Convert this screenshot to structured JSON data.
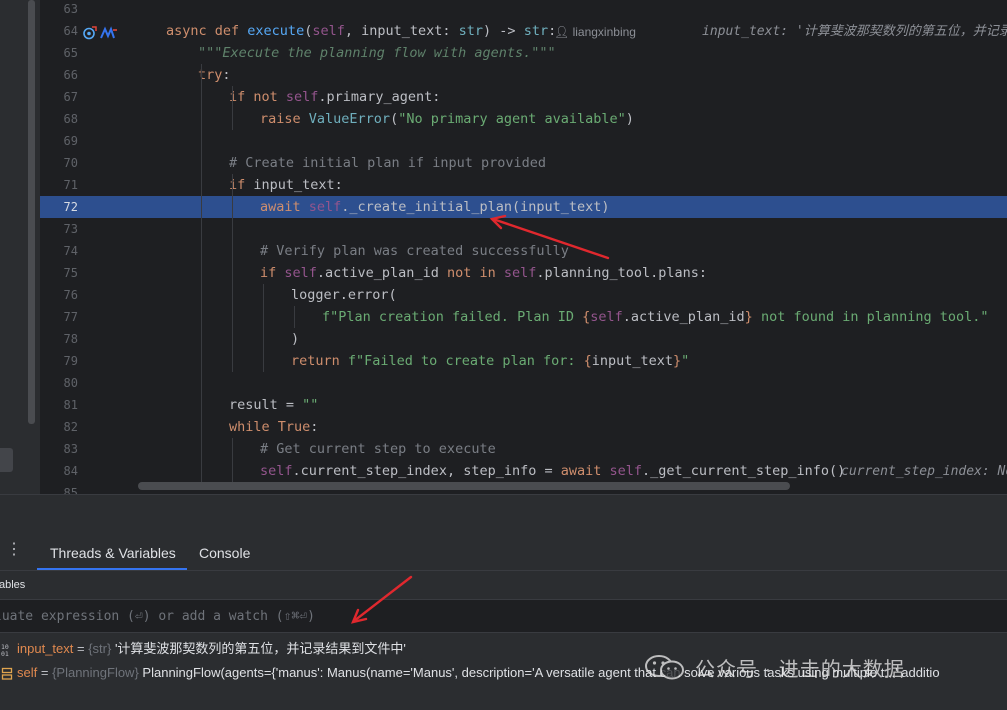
{
  "editor": {
    "author": "liangxinbing",
    "inline_hints": {
      "line_64": "input_text: '计算斐波那契数列的第五位，并记录",
      "line_84": "current_step_index: No"
    },
    "lines": [
      {
        "n": "63"
      },
      {
        "n": "64"
      },
      {
        "n": "65"
      },
      {
        "n": "66"
      },
      {
        "n": "67"
      },
      {
        "n": "68"
      },
      {
        "n": "69"
      },
      {
        "n": "70"
      },
      {
        "n": "71"
      },
      {
        "n": "72"
      },
      {
        "n": "73"
      },
      {
        "n": "74"
      },
      {
        "n": "75"
      },
      {
        "n": "76"
      },
      {
        "n": "77"
      },
      {
        "n": "78"
      },
      {
        "n": "79"
      },
      {
        "n": "80"
      },
      {
        "n": "81"
      },
      {
        "n": "82"
      },
      {
        "n": "83"
      },
      {
        "n": "84"
      },
      {
        "n": "85"
      }
    ],
    "current_line": "72",
    "code": {
      "l64": [
        "async ",
        "def ",
        "execute",
        "(",
        "self",
        ", input_text: ",
        "str",
        ") -> ",
        "str",
        ":"
      ],
      "l65": "\"\"\"Execute the planning flow with agents.\"\"\"",
      "l66": [
        "try",
        ":"
      ],
      "l67": [
        "if ",
        "not ",
        "self",
        ".primary_agent:"
      ],
      "l68": [
        "raise ",
        "ValueError",
        "(",
        "\"No primary agent available\"",
        ")"
      ],
      "l70": "# Create initial plan if input provided",
      "l71": [
        "if ",
        "input_text:"
      ],
      "l72": [
        "await ",
        "self",
        "._create_initial_plan(input_text)"
      ],
      "l74": "# Verify plan was created successfully",
      "l75": [
        "if ",
        "self",
        ".active_plan_id ",
        "not in ",
        "self",
        ".planning_tool.plans:"
      ],
      "l76": "logger.error(",
      "l77": [
        "f\"Plan creation failed. Plan ID ",
        "{",
        "self",
        ".active_plan_id",
        "}",
        " not found in planning tool.\""
      ],
      "l78": ")",
      "l79": [
        "return ",
        "f\"Failed to create plan for: ",
        "{",
        "input_text",
        "}",
        "\""
      ],
      "l81": [
        "result = ",
        "\"\""
      ],
      "l82": [
        "while ",
        "True",
        ":"
      ],
      "l83": "# Get current step to execute",
      "l84": [
        "self",
        ".current_step_index, step_info = ",
        "await ",
        "self",
        "._get_current_step_info()"
      ]
    }
  },
  "debug": {
    "tabs": [
      "Threads & Variables",
      "Console"
    ],
    "active_tab": "Threads & Variables",
    "section_title": "ables",
    "eval_placeholder": "luate expression (⏎) or add a watch (⇧⌘⏎)",
    "variables": [
      {
        "name": "input_text",
        "type": "{str}",
        "value": "'计算斐波那契数列的第五位，并记录结果到文件中'",
        "icon": "string-var-icon"
      },
      {
        "name": "self",
        "type": "{PlanningFlow}",
        "value": "PlanningFlow(agents={'manus': Manus(name='Manus', description='A versatile agent that can solve various tasks using multiple t...' additio",
        "icon": "object-var-icon"
      }
    ]
  },
  "watermark": {
    "text": "公众号 · 进击的大数据"
  },
  "colors": {
    "editor_bg": "#1e1f22",
    "panel_bg": "#2b2d30",
    "current_line_bg": "#2d4f8f",
    "keyword": "#cf8e6d",
    "function": "#56a8f5",
    "self": "#94558d",
    "string": "#6aab73",
    "comment": "#7a7e85",
    "tab_underline": "#3574f0",
    "variable_name": "#e0894f",
    "arrow": "#e0282e"
  }
}
